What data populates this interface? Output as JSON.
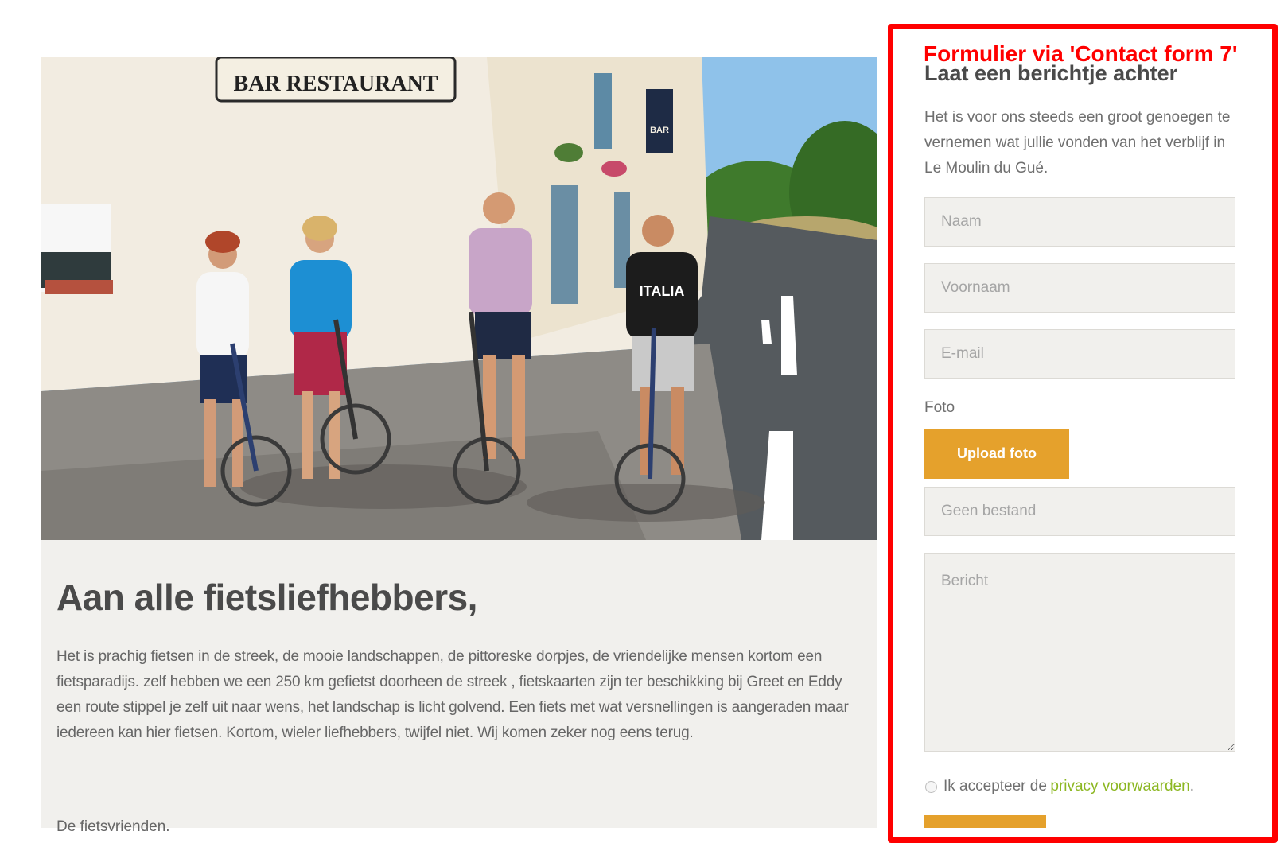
{
  "post": {
    "title": "Aan alle fietsliefhebbers,",
    "body": "Het is prachig fietsen in de streek, de mooie landschappen, de pittoreske dorpjes, de vriendelijke mensen kortom een fietsparadijs. zelf hebben we een 250 km gefietst doorheen de streek , fietskaarten zijn ter beschikking bij Greet en Eddy een route stippel je zelf uit naar wens, het landschap is licht golvend. Een fiets met wat versnellingen is aangeraden maar iedereen kan hier fietsen. Kortom, wieler liefhebbers, twijfel niet. Wij komen zeker nog eens terug.",
    "signature": "De fietsvrienden.",
    "photo": {
      "sign_text": "BAR RESTAURANT",
      "shirt_text": "ITALIA",
      "hanging_sign_text": "BAR"
    }
  },
  "annotation": "Formulier via 'Contact form 7'",
  "form": {
    "title": "Laat een berichtje achter",
    "intro": "Het is voor ons steeds een groot genoegen te vernemen wat jullie vonden van het verblijf in Le Moulin du Gué.",
    "naam_placeholder": "Naam",
    "voornaam_placeholder": "Voornaam",
    "email_placeholder": "E-mail",
    "foto_label": "Foto",
    "upload_label": "Upload foto",
    "file_status": "Geen bestand",
    "bericht_placeholder": "Bericht",
    "consent_prefix": "Ik accepteer de",
    "consent_link": "privacy voorwaarden",
    "consent_suffix": "."
  },
  "colors": {
    "frame": "#ff0000",
    "accent": "#e5a12c",
    "link": "#8cb722",
    "field_bg": "#f1f0ed"
  }
}
